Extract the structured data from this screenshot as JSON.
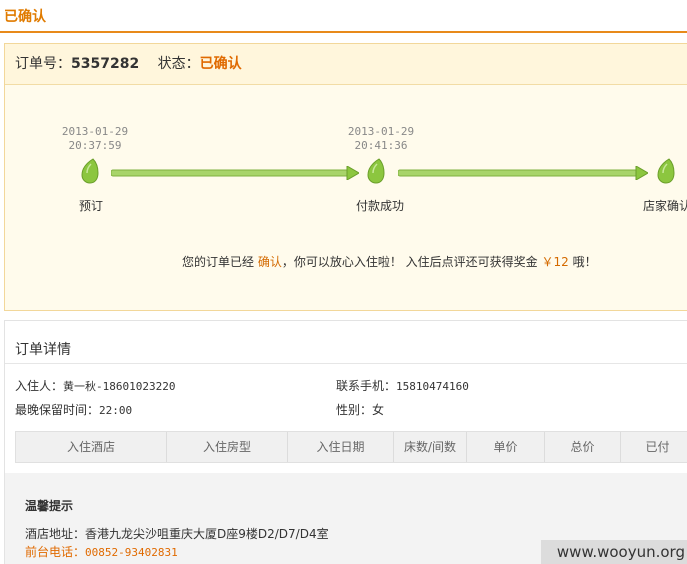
{
  "page_title": "已确认",
  "order": {
    "number_label": "订单号：",
    "number": "5357282",
    "status_label": "状态：",
    "status": "已确认"
  },
  "progress": {
    "steps": [
      {
        "date": "2013-01-29",
        "time": "20:37:59",
        "label": "预订"
      },
      {
        "date": "2013-01-29",
        "time": "20:41:36",
        "label": "付款成功"
      },
      {
        "date": "",
        "time": "",
        "label": "店家确认"
      }
    ]
  },
  "message": {
    "pre": "您的订单已经",
    "highlight": "确认",
    "mid": "，你可以放心入住啦！ 入住后点评还可获得奖金",
    "amount": "￥12",
    "post": "哦！"
  },
  "details": {
    "title": "订单详情",
    "guest_label": "入住人：",
    "guest_value": "黄一秋-18601023220",
    "phone_label": "联系手机：",
    "phone_value": "15810474160",
    "latest_label": "最晚保留时间：",
    "latest_value": "22:00",
    "gender_label": "性别：",
    "gender_value": "女"
  },
  "table": {
    "headers": [
      "入住酒店",
      "入住房型",
      "入住日期",
      "床数/间数",
      "单价",
      "总价",
      "已付"
    ]
  },
  "tips": {
    "title": "温馨提示",
    "address_label": "酒店地址：",
    "address": "香港九龙尖沙咀重庆大厦D座9楼D2/D7/D4室",
    "phone_label": "前台电话：",
    "phone": "00852-93402831"
  },
  "watermark": "www.wooyun.org",
  "colors": {
    "accent": "#e06a00",
    "highlight_box": "#fffbec",
    "progress_green": "#8cc63f"
  }
}
